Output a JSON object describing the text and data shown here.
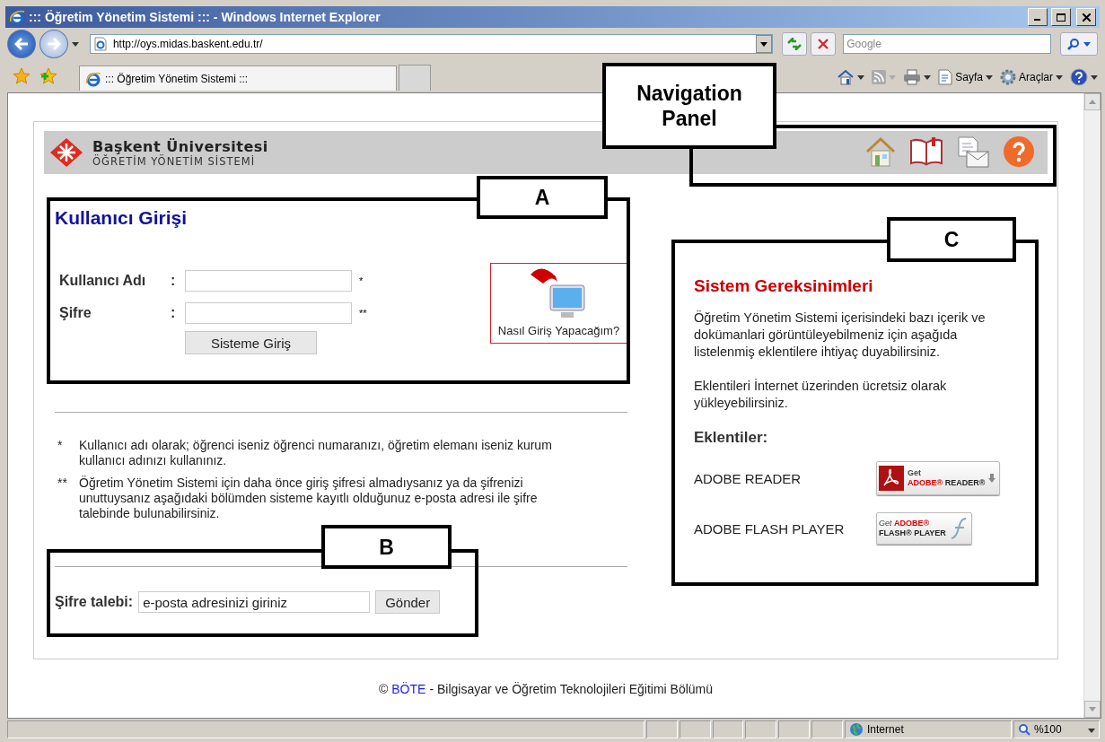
{
  "window": {
    "title": "::: Öğretim Yönetim Sistemi ::: - Windows Internet Explorer"
  },
  "address_bar": {
    "url": "http://oys.midas.baskent.edu.tr/"
  },
  "search": {
    "placeholder": "Google"
  },
  "tabs": [
    {
      "label": "::: Öğretim Yönetim Sistemi :::",
      "selected": true
    }
  ],
  "command_bar": [
    {
      "kind": "home"
    },
    {
      "kind": "feed"
    },
    {
      "kind": "print"
    },
    {
      "kind": "page",
      "label": "Sayfa"
    },
    {
      "kind": "tools",
      "label": "Araçlar"
    },
    {
      "kind": "help"
    }
  ],
  "page": {
    "header": {
      "title": "Başkent Üniversitesi",
      "subtitle": "ÖĞRETİM YÖNETİM SİSTEMİ",
      "nav": [
        {
          "kind": "home"
        },
        {
          "kind": "book"
        },
        {
          "kind": "mail"
        },
        {
          "kind": "help"
        }
      ]
    },
    "login": {
      "title": "Kullanıcı Girişi",
      "fields": [
        {
          "label": "Kullanıcı Adı",
          "separator": ":",
          "note": "*"
        },
        {
          "label": "Şifre",
          "separator": ":",
          "note": "**"
        }
      ],
      "submit": "Sisteme Giriş",
      "help": "Nasıl Giriş Yapacağım?"
    },
    "notes": [
      {
        "mark": "*",
        "text": "Kullanıcı adı olarak; öğrenci iseniz öğrenci numaranızı, öğretim elemanı iseniz kurum kullanıcı adınızı kullanınız."
      },
      {
        "mark": "**",
        "text": "Öğretim Yönetim Sistemi için daha önce giriş şifresi almadıysanız ya da şifrenizi unuttuysanız aşağıdaki bölümden sisteme kayıtlı olduğunuz e-posta adresi ile şifre talebinde bulunabilirsiniz."
      }
    ],
    "password_request": {
      "label": "Şifre talebi:",
      "value": "e-posta adresinizi giriniz",
      "button": "Gönder"
    },
    "requirements": {
      "title": "Sistem Gereksinimleri",
      "paragraphs": [
        "Öğretim Yönetim Sistemi içerisindeki bazı içerik ve dokümanlari görüntüleyebilmeniz için aşağıda listelenmiş eklentilere ihtiyaç duyabilirsiniz.",
        "Eklentileri İnternet üzerinden ücretsiz olarak yükleyebilirsiniz."
      ],
      "plugins_title": "Eklentiler:",
      "plugins": [
        {
          "name": "ADOBE READER",
          "kind": "reader",
          "badge_top": "Get",
          "badge_brand": "ADOBE®",
          "badge_product": "READER®"
        },
        {
          "name": "ADOBE FLASH PLAYER",
          "kind": "flash",
          "badge_top": "Get",
          "badge_brand": "ADOBE®",
          "badge_product": "FLASH® PLAYER"
        }
      ]
    },
    "footer": {
      "prefix": "©",
      "link": "BÖTE",
      "text": "- Bilgisayar ve Öğretim Teknolojileri Eğitimi Bölümü"
    }
  },
  "annotations": [
    {
      "label": "Navigation Panel"
    },
    {
      "label": "A"
    },
    {
      "label": "B"
    },
    {
      "label": "C"
    }
  ],
  "status_bar": {
    "zone": "Internet",
    "zoom": "%100"
  }
}
